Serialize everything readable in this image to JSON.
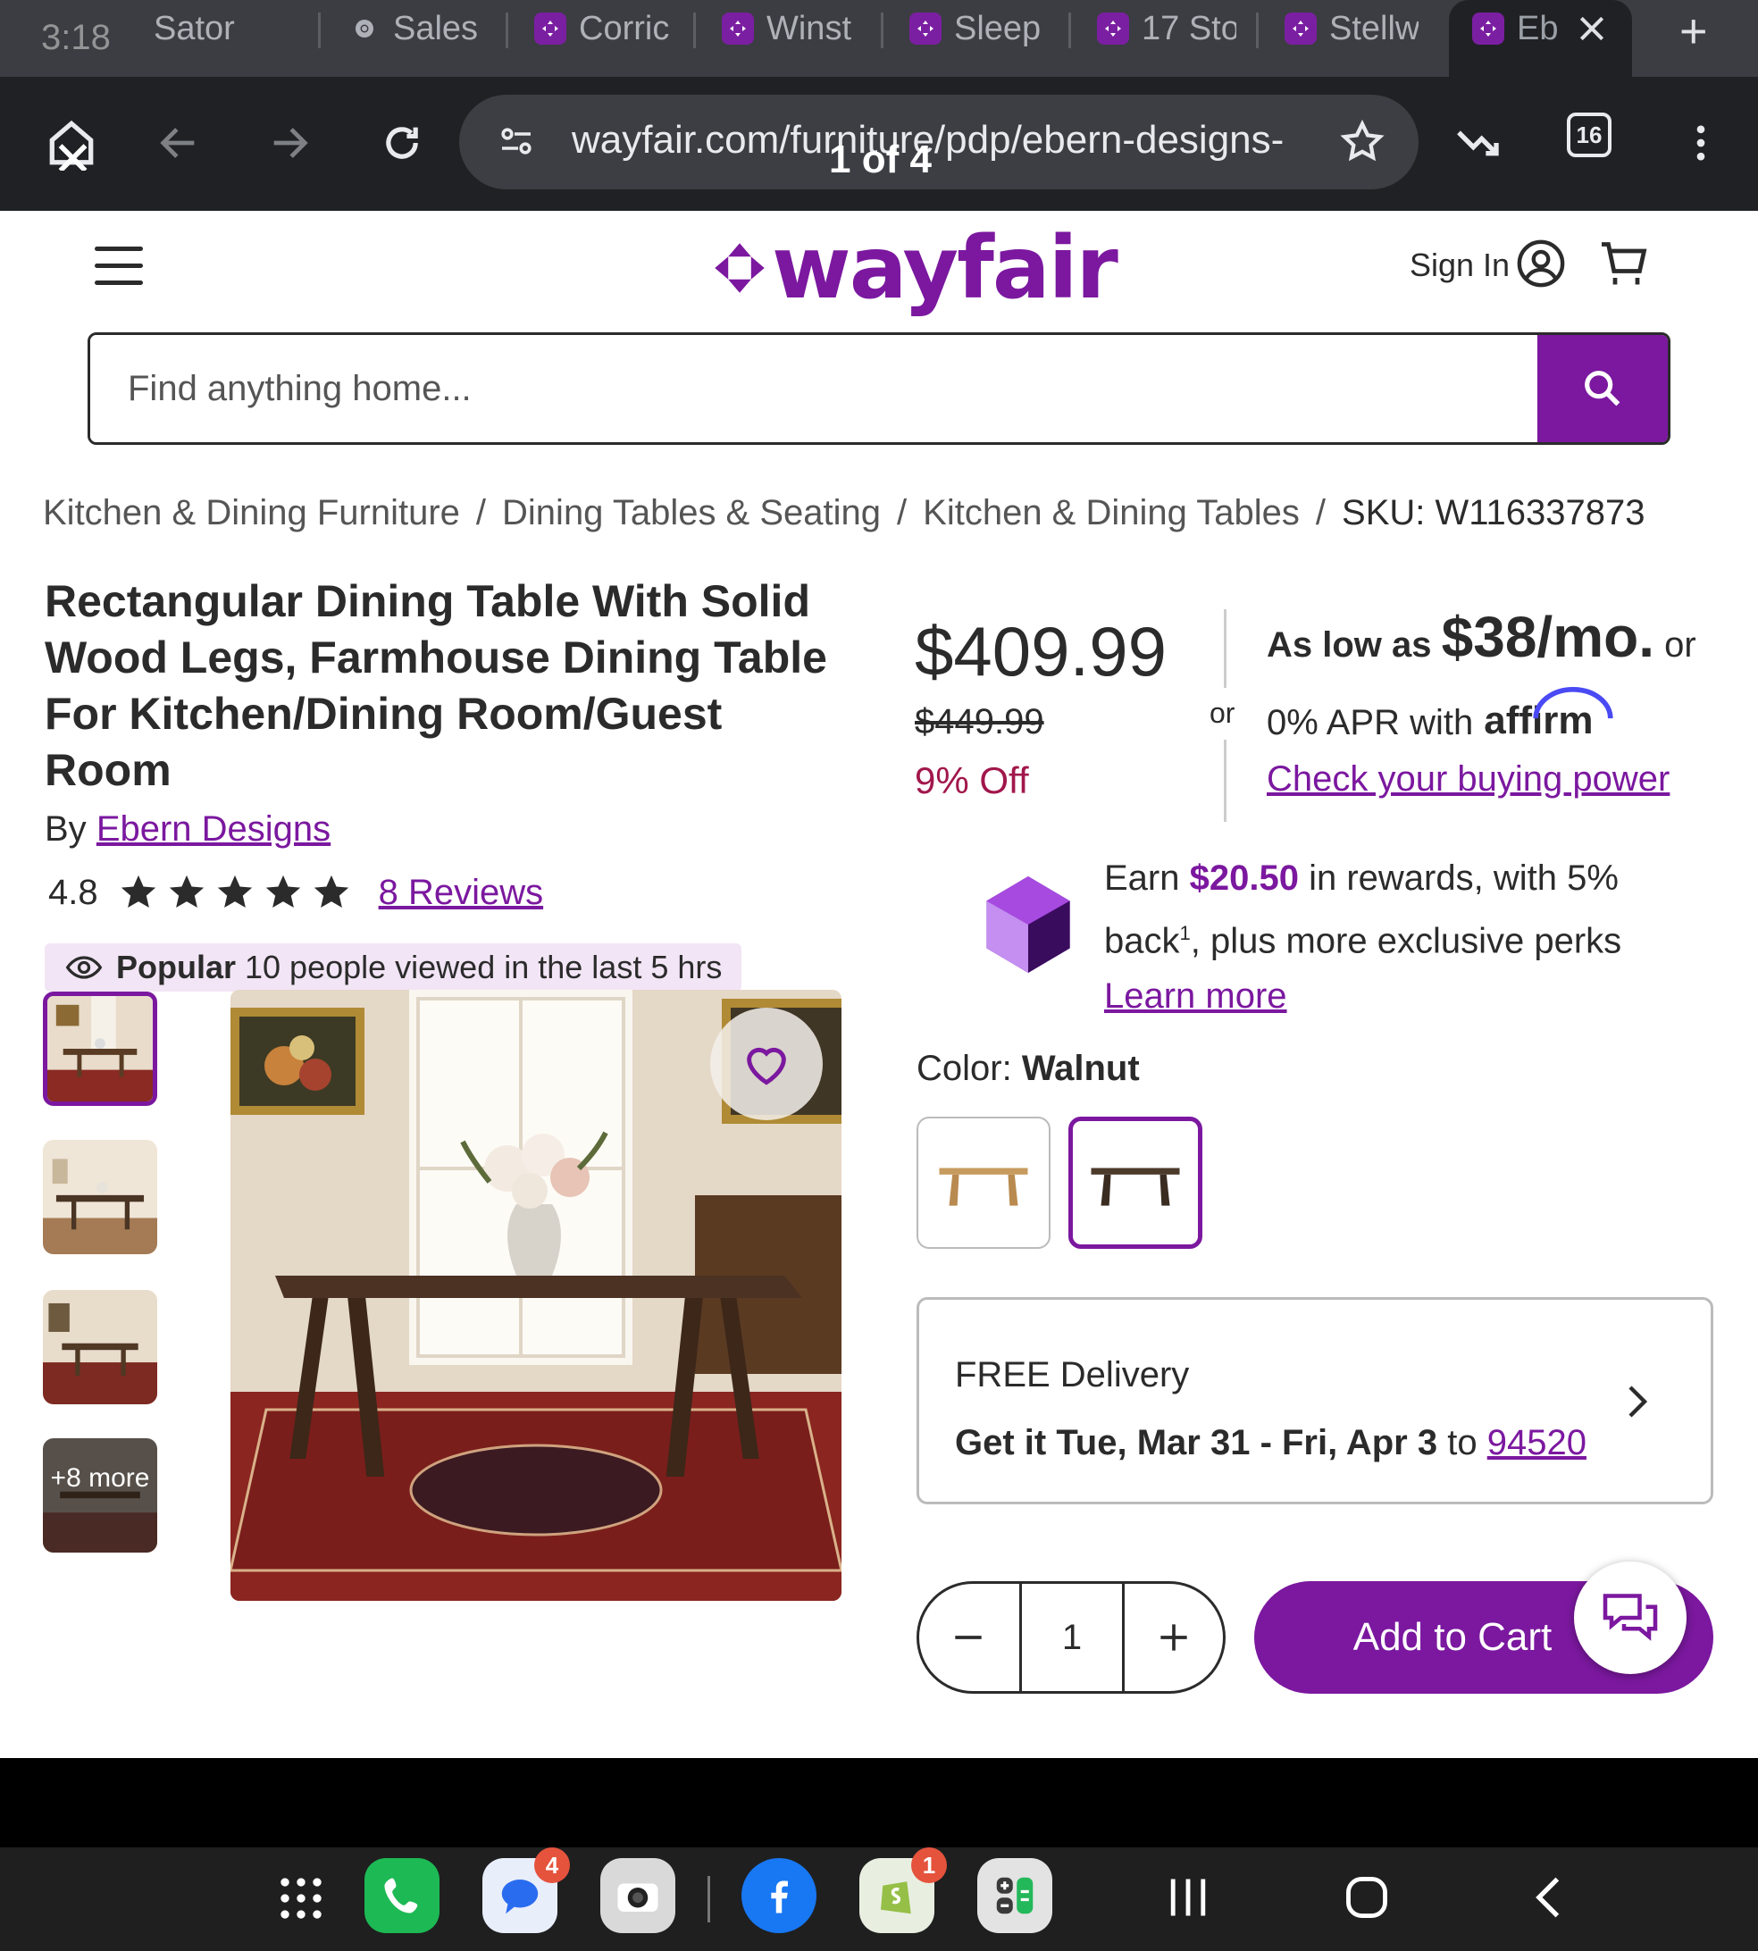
{
  "status_bar": {
    "time": "3:18"
  },
  "tabs": [
    {
      "label": "Sator",
      "icon": "wayfair-tab-icon"
    },
    {
      "label": "Sales",
      "icon": "chrome-icon"
    },
    {
      "label": "Corric",
      "icon": "wayfair-tab-icon"
    },
    {
      "label": "Winst",
      "icon": "wayfair-tab-icon"
    },
    {
      "label": "Sleep",
      "icon": "wayfair-tab-icon"
    },
    {
      "label": "17 Sto",
      "icon": "wayfair-tab-icon"
    },
    {
      "label": "Stellw",
      "icon": "wayfair-tab-icon"
    },
    {
      "label": "Eb",
      "icon": "wayfair-tab-icon",
      "active": true
    }
  ],
  "browser": {
    "url": "wayfair.com/furniture/pdp/ebern-designs-",
    "find_count": "1 of 4",
    "tab_count": "16"
  },
  "header": {
    "logo_text": "wayfair",
    "sign_in": "Sign In",
    "search_placeholder": "Find anything home..."
  },
  "breadcrumb": [
    "Kitchen & Dining Furniture",
    "Dining Tables & Seating",
    "Kitchen & Dining Tables",
    "SKU: W116337873"
  ],
  "product": {
    "title": "Rectangular Dining Table With Solid Wood Legs, Farmhouse Dining Table For Kitchen/Dining Room/Guest Room",
    "by_prefix": "By",
    "brand": "Ebern Designs",
    "rating": "4.8",
    "stars": 5,
    "reviews": "8 Reviews",
    "popular_label": "Popular",
    "popular_text": "10 people viewed in the last 5 hrs",
    "more_thumbs": "+8 more"
  },
  "pricing": {
    "price": "$409.99",
    "was": "$449.99",
    "off": "9% Off",
    "or_mid": "or",
    "as_low_prefix": "As low as",
    "monthly": "$38/mo.",
    "as_low_suffix": "or",
    "apr_text": "0% APR with",
    "affirm": "affirm",
    "check_power": "Check your buying power"
  },
  "rewards": {
    "prefix": "Earn",
    "amount": "$20.50",
    "text_a": "in rewards, with 5% back",
    "sup": "1",
    "text_b": ", plus more exclusive perks",
    "learn_more": "Learn more"
  },
  "color": {
    "label": "Color:",
    "selected": "Walnut"
  },
  "delivery": {
    "title": "FREE Delivery",
    "dates": "Get it Tue, Mar 31 - Fri, Apr 3",
    "to": "to",
    "zip": "94520"
  },
  "cart": {
    "quantity": "1",
    "add_label": "Add to Cart"
  },
  "dock": {
    "messages_badge": "4",
    "shopify_badge": "1"
  },
  "colors": {
    "brand_purple": "#7b189f",
    "discount_red": "#a1174b"
  }
}
